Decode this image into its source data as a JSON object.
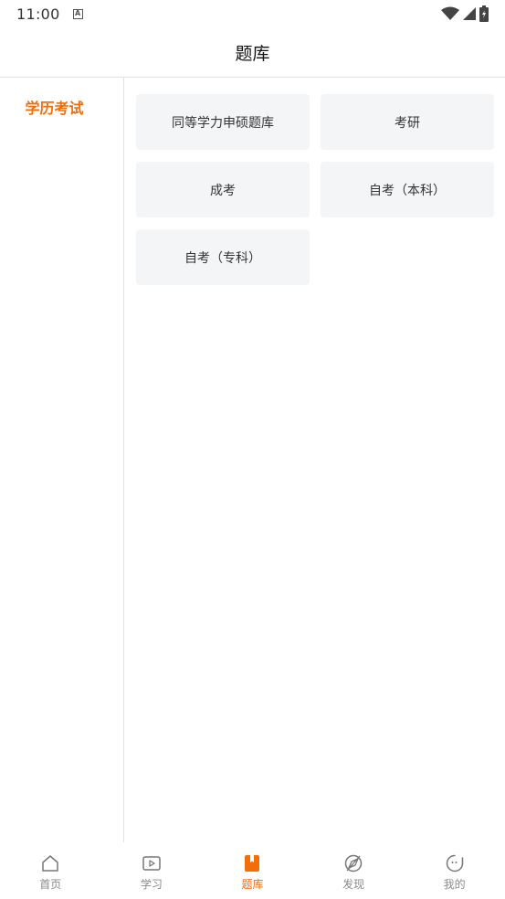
{
  "status_bar": {
    "time": "11:00",
    "notif_glyph": "A"
  },
  "header": {
    "title": "题库"
  },
  "sidebar": {
    "items": [
      {
        "label": "学历考试",
        "selected": true
      }
    ]
  },
  "categories": [
    {
      "label": "同等学力申硕题库"
    },
    {
      "label": "考研"
    },
    {
      "label": "成考"
    },
    {
      "label": "自考（本科）"
    },
    {
      "label": "自考（专科）"
    }
  ],
  "tabbar": {
    "items": [
      {
        "label": "首页",
        "icon": "home-icon"
      },
      {
        "label": "学习",
        "icon": "play-icon"
      },
      {
        "label": "题库",
        "icon": "bookmark-book-icon",
        "active": true
      },
      {
        "label": "发现",
        "icon": "compass-icon"
      },
      {
        "label": "我的",
        "icon": "face-icon"
      }
    ]
  },
  "colors": {
    "accent": "#f46d0b",
    "card_bg": "#f4f5f7",
    "inactive": "#8a8a8a"
  }
}
